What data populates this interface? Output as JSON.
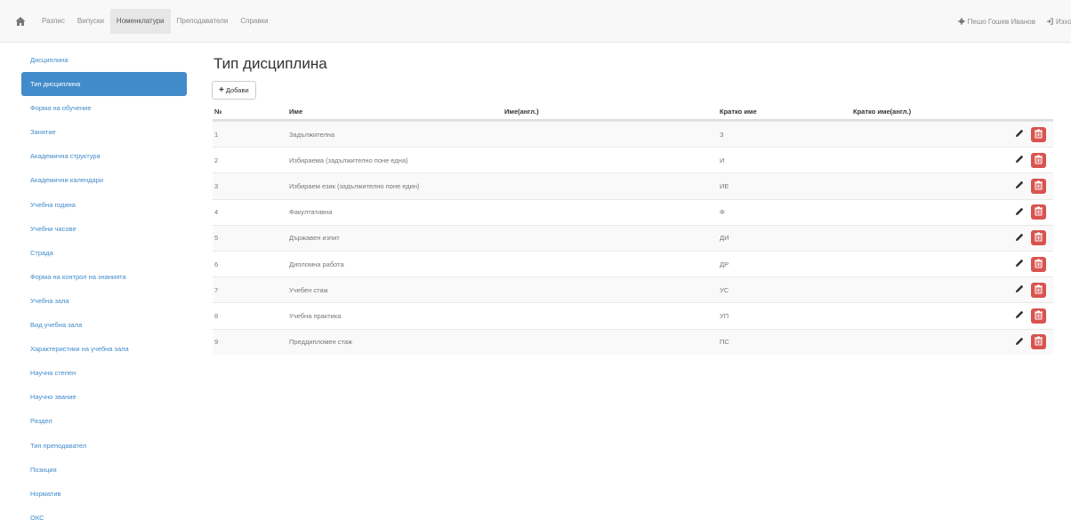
{
  "navbar": {
    "home_icon": "home-icon",
    "links": [
      {
        "label": "Разпис",
        "active": false
      },
      {
        "label": "Випуски",
        "active": false
      },
      {
        "label": "Номенклатури",
        "active": true
      },
      {
        "label": "Преподаватели",
        "active": false
      },
      {
        "label": "Справки",
        "active": false
      }
    ],
    "user_label": "Пешо Гошев Иванов",
    "logout_label": "Изход"
  },
  "sidebar": {
    "items": [
      {
        "label": "Дисциплина",
        "active": false
      },
      {
        "label": "Тип дисциплина",
        "active": true
      },
      {
        "label": "Форма на обучение",
        "active": false
      },
      {
        "label": "Занятие",
        "active": false
      },
      {
        "label": "Академична структура",
        "active": false
      },
      {
        "label": "Академични календари",
        "active": false
      },
      {
        "label": "Учебна година",
        "active": false
      },
      {
        "label": "Учебни часове",
        "active": false
      },
      {
        "label": "Страда",
        "active": false
      },
      {
        "label": "Форма на контрол на знанията",
        "active": false
      },
      {
        "label": "Учебна зала",
        "active": false
      },
      {
        "label": "Вид учебна зала",
        "active": false
      },
      {
        "label": "Характеристики на учебна зала",
        "active": false
      },
      {
        "label": "Научна степен",
        "active": false
      },
      {
        "label": "Научно звание",
        "active": false
      },
      {
        "label": "Раздел",
        "active": false
      },
      {
        "label": "Тип преподавател",
        "active": false
      },
      {
        "label": "Позиция",
        "active": false
      },
      {
        "label": "Норматив",
        "active": false
      },
      {
        "label": "ОКС",
        "active": false
      }
    ]
  },
  "main": {
    "title": "Тип дисциплина",
    "add_label": "Добави",
    "colors": {
      "accent": "#428bca",
      "danger": "#d9534f"
    },
    "table": {
      "headers": {
        "num": "№",
        "name": "Име",
        "name_en": "Име(англ.)",
        "short": "Кратко име",
        "short_en": "Кратко име(англ.)"
      },
      "rows": [
        {
          "num": "1",
          "name": "Задължителна",
          "name_en": "",
          "short": "З",
          "short_en": ""
        },
        {
          "num": "2",
          "name": "Избираема (задължително поне една)",
          "name_en": "",
          "short": "И",
          "short_en": ""
        },
        {
          "num": "3",
          "name": "Избираем език (задължително поне един)",
          "name_en": "",
          "short": "ИЕ",
          "short_en": ""
        },
        {
          "num": "4",
          "name": "Факултативна",
          "name_en": "",
          "short": "Ф",
          "short_en": ""
        },
        {
          "num": "5",
          "name": "Държавен изпит",
          "name_en": "",
          "short": "ДИ",
          "short_en": ""
        },
        {
          "num": "6",
          "name": "Дипломна работа",
          "name_en": "",
          "short": "ДР",
          "short_en": ""
        },
        {
          "num": "7",
          "name": "Учебен стаж",
          "name_en": "",
          "short": "УС",
          "short_en": ""
        },
        {
          "num": "8",
          "name": "Учебна практика",
          "name_en": "",
          "short": "УП",
          "short_en": ""
        },
        {
          "num": "9",
          "name": "Преддипломен стаж",
          "name_en": "",
          "short": "ПС",
          "short_en": ""
        }
      ]
    }
  }
}
